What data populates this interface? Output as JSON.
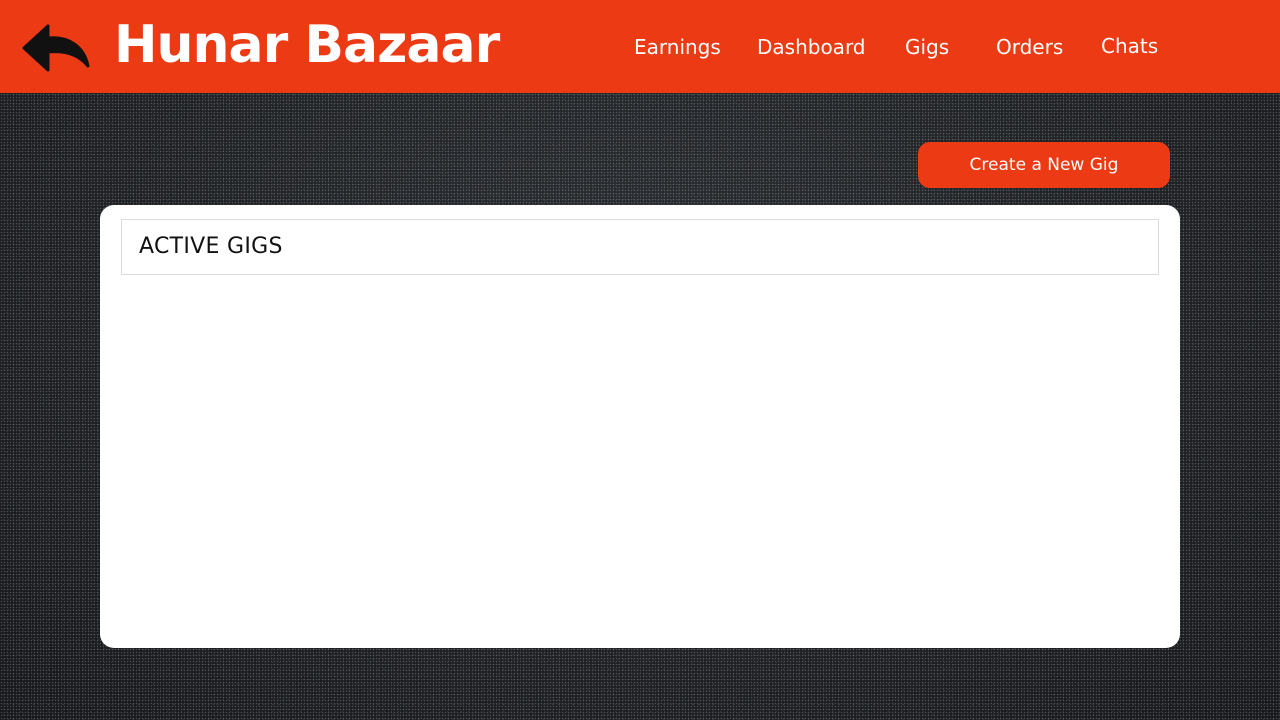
{
  "header": {
    "brand": "Hunar Bazaar",
    "back_icon": "reply-arrow-icon",
    "nav": {
      "earnings": "Earnings",
      "dashboard": "Dashboard",
      "gigs": "Gigs",
      "orders": "Orders",
      "chats": "Chats"
    }
  },
  "actions": {
    "create_gig_label": "Create a New Gig"
  },
  "gigs_panel": {
    "title": "ACTIVE GIGS",
    "items": []
  },
  "colors": {
    "accent": "#ec3b14",
    "panel_bg": "#ffffff",
    "page_bg": "#1c1f22"
  }
}
